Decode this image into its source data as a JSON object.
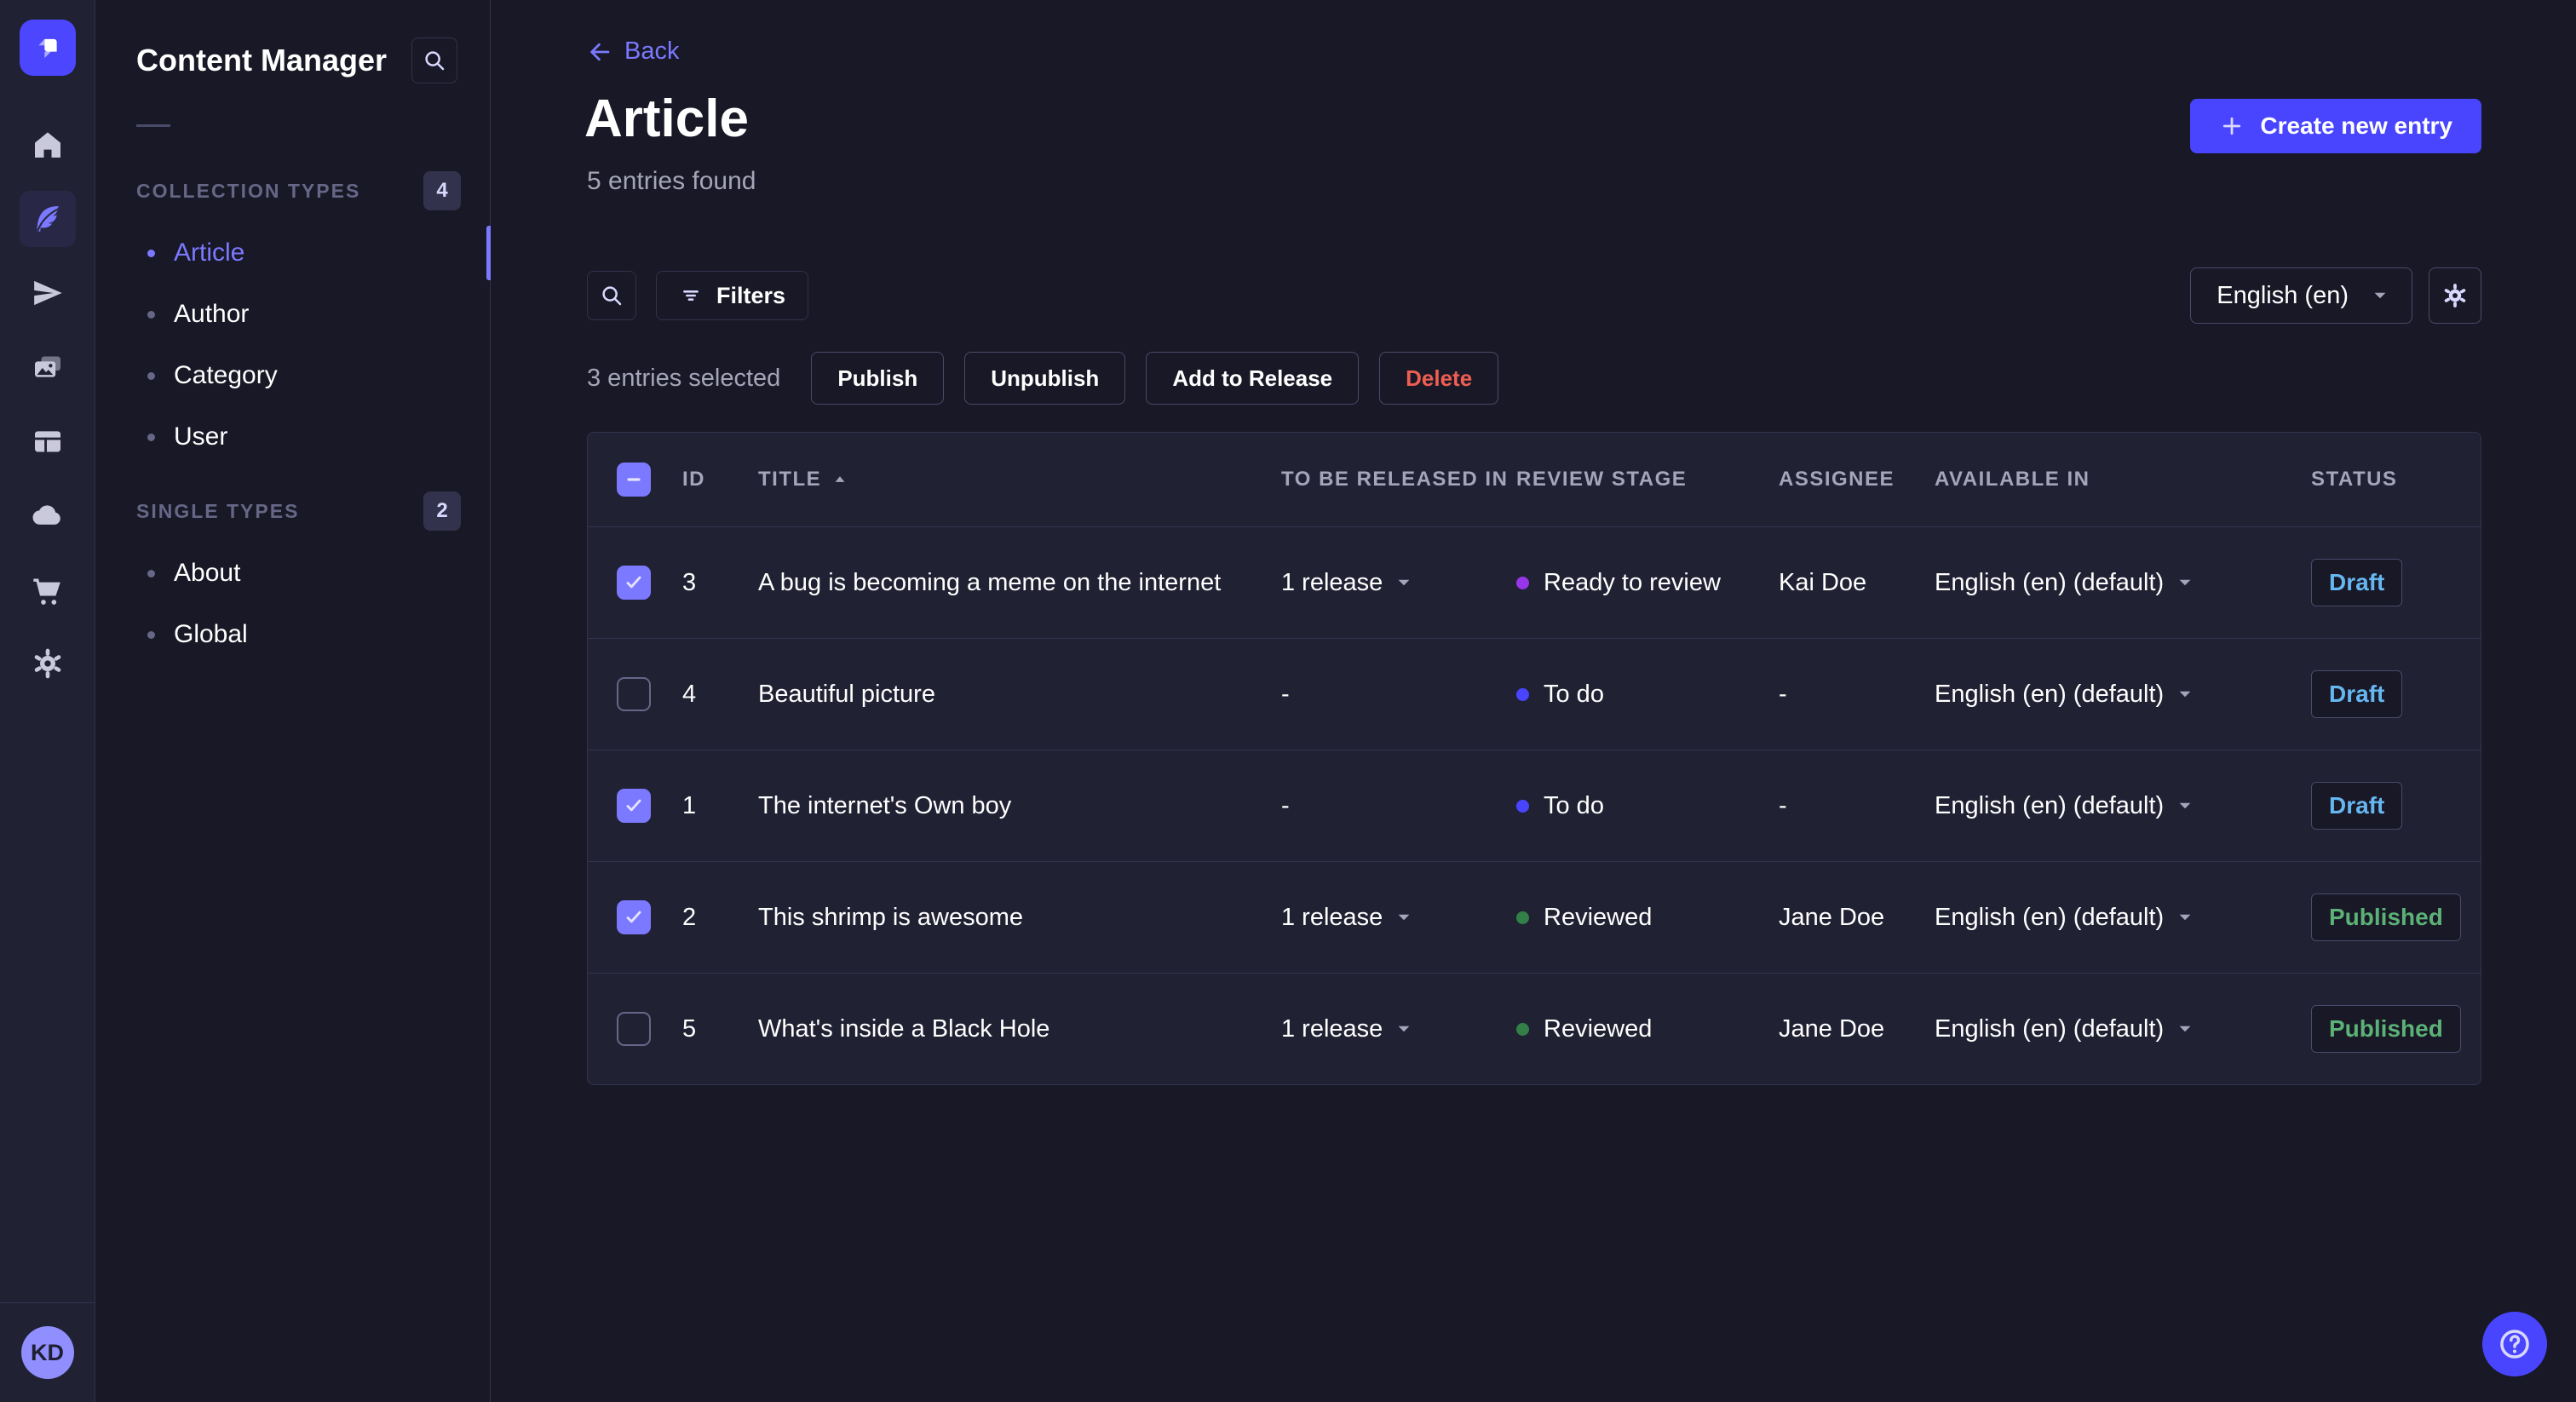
{
  "colors": {
    "brand": "#4945ff",
    "accent_light": "#7b79ff",
    "stage_todo": "#4945ff",
    "stage_ready_to_review": "#9736e8",
    "stage_reviewed": "#328048",
    "status_draft": "#66b7f1",
    "status_published": "#5cb176",
    "danger": "#ee5e52"
  },
  "icon_nav": {
    "logo": "strapi-logo",
    "items": [
      "home-icon",
      "content-manager-feather-icon",
      "releases-paper-plane-icon",
      "media-library-images-icon",
      "content-type-builder-layout-icon",
      "cloud-icon",
      "marketplace-cart-icon",
      "settings-gear-icon"
    ],
    "active_item": "content-manager"
  },
  "user": {
    "initials": "KD"
  },
  "sidebar": {
    "title": "Content Manager",
    "search_icon": "search-icon",
    "sections": [
      {
        "label": "COLLECTION TYPES",
        "count": "4",
        "items": [
          {
            "label": "Article",
            "active": true
          },
          {
            "label": "Author"
          },
          {
            "label": "Category"
          },
          {
            "label": "User"
          }
        ]
      },
      {
        "label": "SINGLE TYPES",
        "count": "2",
        "items": [
          {
            "label": "About"
          },
          {
            "label": "Global"
          }
        ]
      }
    ]
  },
  "header": {
    "back": "Back",
    "title": "Article",
    "entries_found": "5 entries found",
    "create": "Create new entry"
  },
  "toolbar": {
    "filters_label": "Filters",
    "locale_value": "English (en)"
  },
  "selection": {
    "text": "3 entries selected",
    "actions": [
      "Publish",
      "Unpublish",
      "Add to Release",
      "Delete"
    ]
  },
  "table": {
    "select_all_indeterminate": true,
    "sorted_by": "TITLE",
    "sort_direction": "asc",
    "columns": [
      "ID",
      "TITLE",
      "TO BE RELEASED IN",
      "REVIEW STAGE",
      "ASSIGNEE",
      "AVAILABLE IN",
      "STATUS"
    ],
    "rows": [
      {
        "checked": true,
        "id": "3",
        "title": "A bug is becoming a meme on the internet",
        "release": "1 release",
        "has_release_menu": true,
        "stage": "Ready to review",
        "stage_color": "#9736e8",
        "assignee": "Kai Doe",
        "available": "English (en) (default)",
        "status": "Draft",
        "status_color": "#66b7f1"
      },
      {
        "checked": false,
        "id": "4",
        "title": "Beautiful picture",
        "release": "-",
        "has_release_menu": false,
        "stage": "To do",
        "stage_color": "#4945ff",
        "assignee": "-",
        "available": "English (en) (default)",
        "status": "Draft",
        "status_color": "#66b7f1"
      },
      {
        "checked": true,
        "id": "1",
        "title": "The internet's Own boy",
        "release": "-",
        "has_release_menu": false,
        "stage": "To do",
        "stage_color": "#4945ff",
        "assignee": "-",
        "available": "English (en) (default)",
        "status": "Draft",
        "status_color": "#66b7f1"
      },
      {
        "checked": true,
        "id": "2",
        "title": "This shrimp is awesome",
        "release": "1 release",
        "has_release_menu": true,
        "stage": "Reviewed",
        "stage_color": "#328048",
        "assignee": "Jane Doe",
        "available": "English (en) (default)",
        "status": "Published",
        "status_color": "#5cb176"
      },
      {
        "checked": false,
        "id": "5",
        "title": "What's inside a Black Hole",
        "release": "1 release",
        "has_release_menu": true,
        "stage": "Reviewed",
        "stage_color": "#328048",
        "assignee": "Jane Doe",
        "available": "English (en) (default)",
        "status": "Published",
        "status_color": "#5cb176"
      }
    ]
  }
}
